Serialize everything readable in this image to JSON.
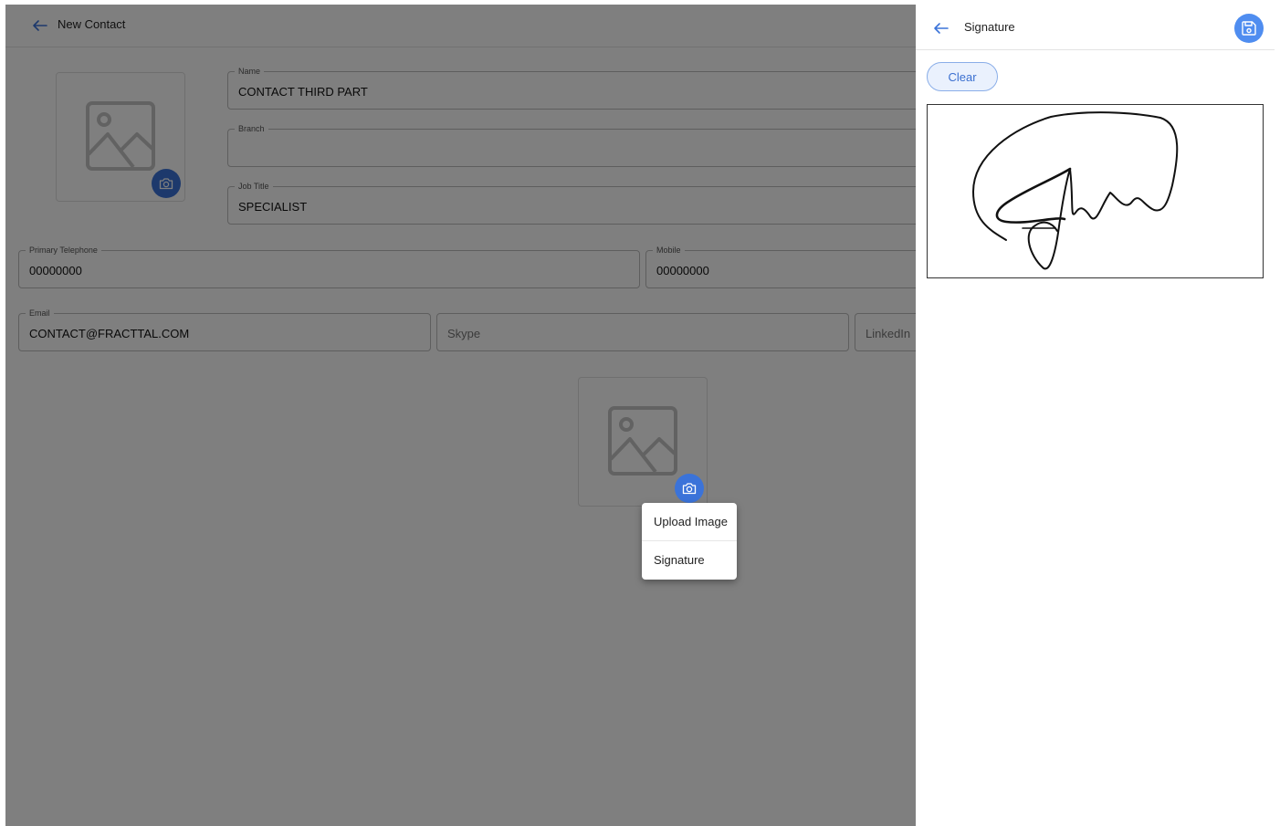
{
  "header": {
    "title": "New Contact",
    "back_icon": "arrow-left-icon"
  },
  "form": {
    "name": {
      "label": "Name",
      "value": "CONTACT THIRD PART"
    },
    "branch": {
      "label": "Branch",
      "value": ""
    },
    "job_title": {
      "label": "Job Title",
      "value": "SPECIALIST"
    },
    "primary_telephone": {
      "label": "Primary Telephone",
      "value": "00000000"
    },
    "mobile": {
      "label": "Mobile",
      "value": "00000000"
    },
    "email": {
      "label": "Email",
      "value": "CONTACT@FRACTTAL.COM"
    },
    "skype": {
      "placeholder": "Skype"
    },
    "linkedin": {
      "placeholder": "LinkedIn"
    }
  },
  "photo_menu": {
    "items": [
      {
        "label": "Upload Image"
      },
      {
        "label": "Signature"
      }
    ]
  },
  "signature_panel": {
    "title": "Signature",
    "clear_label": "Clear",
    "save_icon": "save-icon"
  },
  "colors": {
    "accent": "#3b73d9",
    "save_button": "#4f8df0",
    "clear_bg": "#eaf1fd",
    "overlay": "rgba(0,0,0,0.5)"
  }
}
